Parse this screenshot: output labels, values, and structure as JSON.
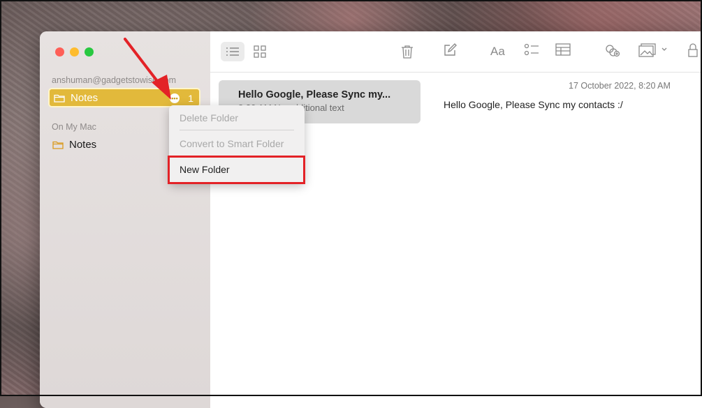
{
  "sidebar": {
    "account_label": "anshuman@gadgetstowise.com",
    "account_folders": [
      {
        "name": "Notes",
        "count": "1"
      }
    ],
    "local_label": "On My Mac",
    "local_folders": [
      {
        "name": "Notes"
      }
    ]
  },
  "note_list": {
    "items": [
      {
        "title": "Hello Google, Please Sync my...",
        "subtitle": "8:20 AM  No additional text"
      }
    ]
  },
  "editor": {
    "date": "17 October 2022, 8:20 AM",
    "body": "Hello Google, Please Sync my contacts :/"
  },
  "context_menu": {
    "items": [
      {
        "label": "Delete Folder",
        "enabled": false
      },
      {
        "label": "Convert to Smart Folder",
        "enabled": false
      },
      {
        "label": "New Folder",
        "enabled": true
      }
    ]
  },
  "colors": {
    "selection": "#e2b93b",
    "highlight": "#e32227",
    "arrow": "#e32227"
  },
  "icons": [
    "folder-icon",
    "more-icon",
    "list-view-icon",
    "gallery-view-icon",
    "trash-icon",
    "compose-icon",
    "format-icon",
    "checklist-icon",
    "table-icon",
    "share-link-icon",
    "media-icon",
    "lock-icon"
  ]
}
